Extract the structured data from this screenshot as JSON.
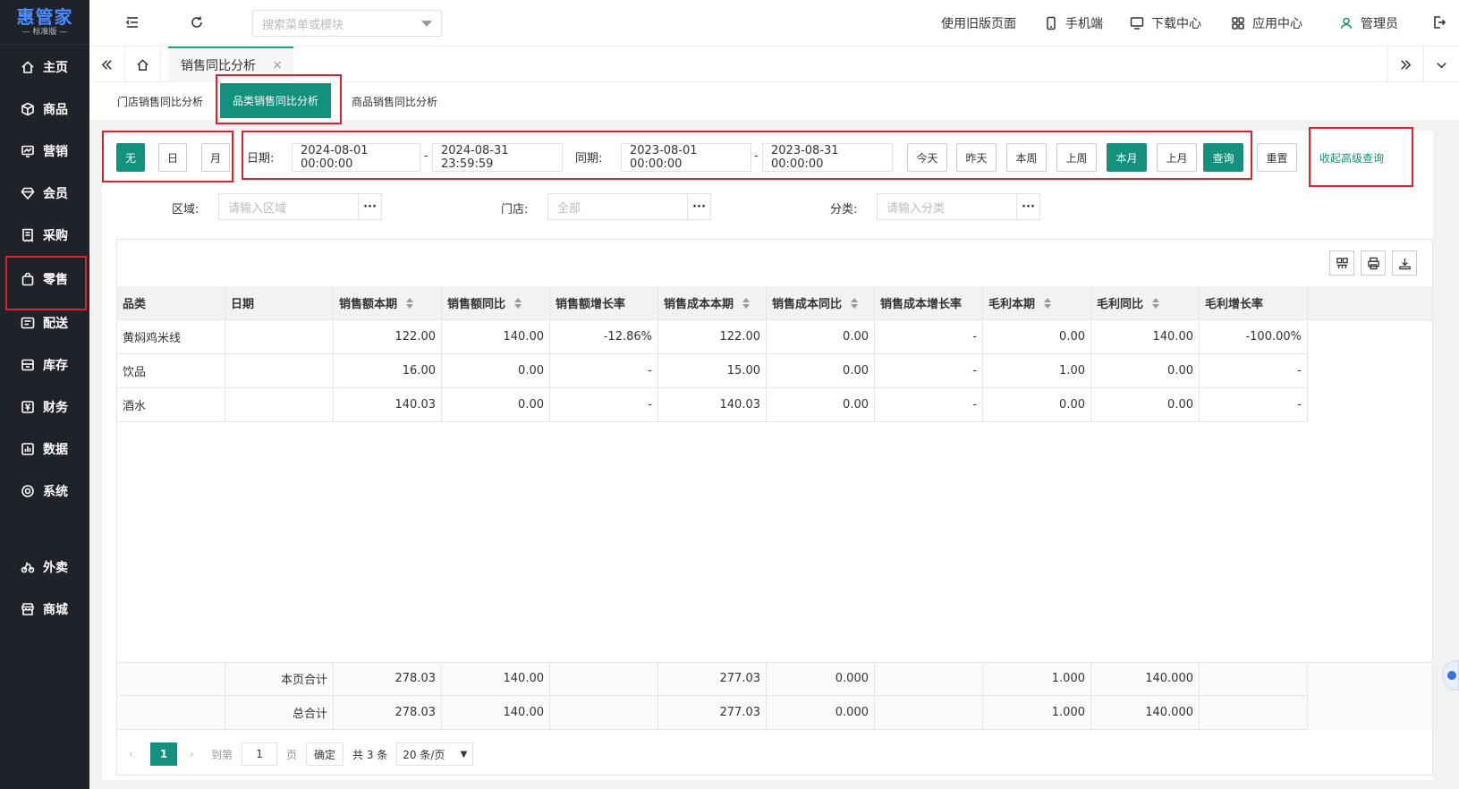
{
  "brand": {
    "name": "惠管家",
    "edition": "— 标准版 —"
  },
  "sidebar": {
    "items": [
      {
        "label": "主页",
        "icon": "home-icon"
      },
      {
        "label": "商品",
        "icon": "box-icon"
      },
      {
        "label": "营销",
        "icon": "chart-board-icon"
      },
      {
        "label": "会员",
        "icon": "diamond-icon"
      },
      {
        "label": "采购",
        "icon": "receipt-icon"
      },
      {
        "label": "零售",
        "icon": "bag-icon"
      },
      {
        "label": "配送",
        "icon": "truck-icon"
      },
      {
        "label": "库存",
        "icon": "inventory-icon"
      },
      {
        "label": "财务",
        "icon": "yen-icon"
      },
      {
        "label": "数据",
        "icon": "bar-chart-icon"
      },
      {
        "label": "系统",
        "icon": "settings-icon"
      },
      {
        "label": "外卖",
        "icon": "bike-icon"
      },
      {
        "label": "商城",
        "icon": "store-icon"
      }
    ]
  },
  "topbar": {
    "search_placeholder": "搜索菜单或模块",
    "old_version": "使用旧版页面",
    "mobile": "手机端",
    "download": "下载中心",
    "apps": "应用中心",
    "user": "管理员"
  },
  "tabs": {
    "current": "销售同比分析",
    "close": "×"
  },
  "sub_tabs": [
    "门店销售同比分析",
    "品类销售同比分析",
    "商品销售同比分析"
  ],
  "query": {
    "granularity": [
      "无",
      "日",
      "月"
    ],
    "date_label": "日期:",
    "date_start": "2024-08-01 00:00:00",
    "date_end": "2024-08-31 23:59:59",
    "compare_label": "同期:",
    "compare_start": "2023-08-01 00:00:00",
    "compare_end": "2023-08-31 00:00:00",
    "dash": "-",
    "quick": [
      "今天",
      "昨天",
      "本周",
      "上周",
      "本月",
      "上月"
    ],
    "search_btn": "查询",
    "reset_btn": "重置",
    "advanced_link": "收起高级查询",
    "region_label": "区域:",
    "region_placeholder": "请输入区域",
    "store_label": "门店:",
    "store_placeholder": "全部",
    "category_label": "分类:",
    "category_placeholder": "请输入分类",
    "dots": "···"
  },
  "table": {
    "columns": [
      "品类",
      "日期",
      "销售额本期",
      "销售额同比",
      "销售额增长率",
      "销售成本本期",
      "销售成本同比",
      "销售成本增长率",
      "毛利本期",
      "毛利同比",
      "毛利增长率"
    ],
    "rows": [
      [
        "黄焖鸡米线",
        "",
        "122.00",
        "140.00",
        "-12.86%",
        "122.00",
        "0.00",
        "-",
        "0.00",
        "140.00",
        "-100.00%"
      ],
      [
        "饮品",
        "",
        "16.00",
        "0.00",
        "-",
        "15.00",
        "0.00",
        "-",
        "1.00",
        "0.00",
        "-"
      ],
      [
        "酒水",
        "",
        "140.03",
        "0.00",
        "-",
        "140.03",
        "0.00",
        "-",
        "0.00",
        "0.00",
        "-"
      ]
    ],
    "footer": [
      [
        "",
        "本页合计",
        "278.03",
        "140.00",
        "",
        "277.03",
        "0.000",
        "",
        "1.000",
        "140.000",
        ""
      ],
      [
        "",
        "总合计",
        "278.03",
        "140.00",
        "",
        "277.03",
        "0.000",
        "",
        "1.000",
        "140.000",
        ""
      ]
    ]
  },
  "pager": {
    "current": "1",
    "goto": "到第",
    "page_input": "1",
    "page_unit": "页",
    "confirm": "确定",
    "total": "共 3 条",
    "page_size": "20 条/页"
  },
  "colors": {
    "primary": "#13917c",
    "sidebar": "#1f2329",
    "highlight": "#e0202a"
  }
}
